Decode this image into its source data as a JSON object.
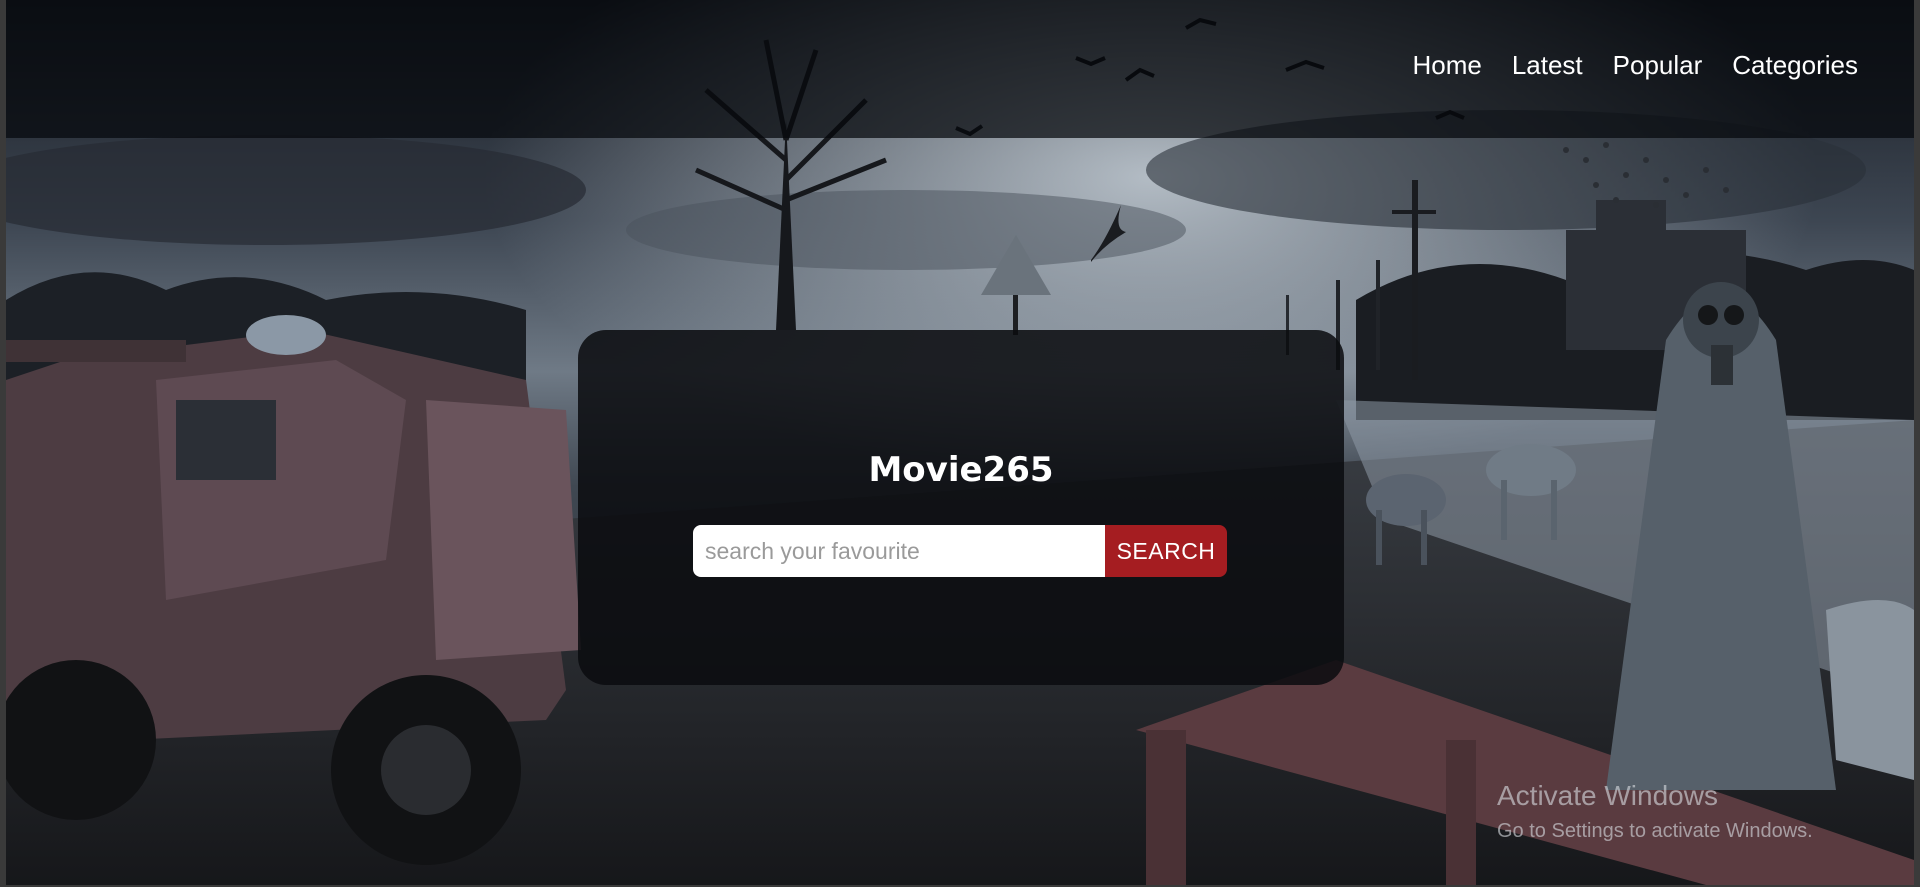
{
  "nav": {
    "items": [
      {
        "label": "Home"
      },
      {
        "label": "Latest"
      },
      {
        "label": "Popular"
      },
      {
        "label": "Categories"
      }
    ]
  },
  "hero": {
    "title": "Movie265",
    "search": {
      "placeholder": "search your favourite",
      "value": "",
      "button_label": "SEARCH"
    }
  },
  "watermark": {
    "title": "Activate Windows",
    "subtitle": "Go to Settings to activate Windows."
  },
  "colors": {
    "accent": "#a51d21",
    "card": "#0a0c0f",
    "text": "#ffffff"
  }
}
